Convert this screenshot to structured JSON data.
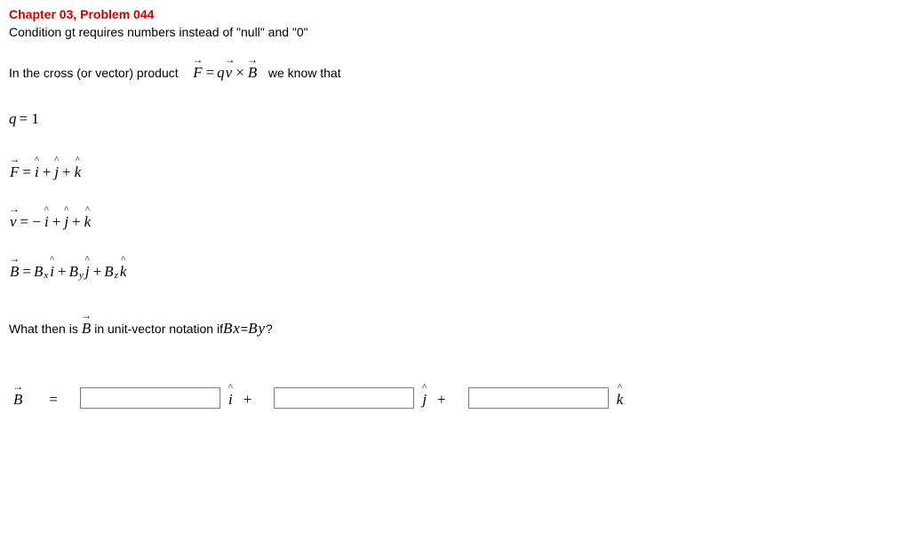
{
  "title": "Chapter 03, Problem 044",
  "condition": "Condition gt requires numbers instead of \"null\" and \"0\"",
  "intro_pre": "In the cross (or vector) product    ",
  "intro_post": "   we know that",
  "eq_product": {
    "F": "F",
    "eq": " = ",
    "q": "q ",
    "v": "v",
    "x": " × ",
    "B": "B"
  },
  "q_line": {
    "q": "q",
    "eq": " = 1"
  },
  "F_line": {
    "F": "F",
    "eq": " = ",
    "i": "i",
    "p1": " + ",
    "j": "j",
    "p2": " + ",
    "k": "k"
  },
  "v_line": {
    "v": "v",
    "eq": " =  − ",
    "i": "i",
    "p1": " + ",
    "j": "j",
    "p2": " + ",
    "k": "k"
  },
  "B_line": {
    "B": "B",
    "eq": " = ",
    "Bx": "B",
    "x": "x",
    "i": "i",
    "p1": " + ",
    "By": "B",
    "y": "y",
    "j": "j",
    "p2": " + ",
    "Bz": "B",
    "z": "z",
    "k": "k"
  },
  "question": {
    "pre": "What then is  ",
    "B": "B",
    "mid": "  in unit-vector notation if ",
    "Bx": "B",
    "x": "x",
    "eq": " = ",
    "By": "B",
    "y": "y",
    "qmark": "?"
  },
  "answer": {
    "B": "B",
    "eq": "=",
    "i": "i",
    "p1": "+",
    "j": "j",
    "p2": "+",
    "k": "k",
    "val_i": "",
    "val_j": "",
    "val_k": ""
  }
}
